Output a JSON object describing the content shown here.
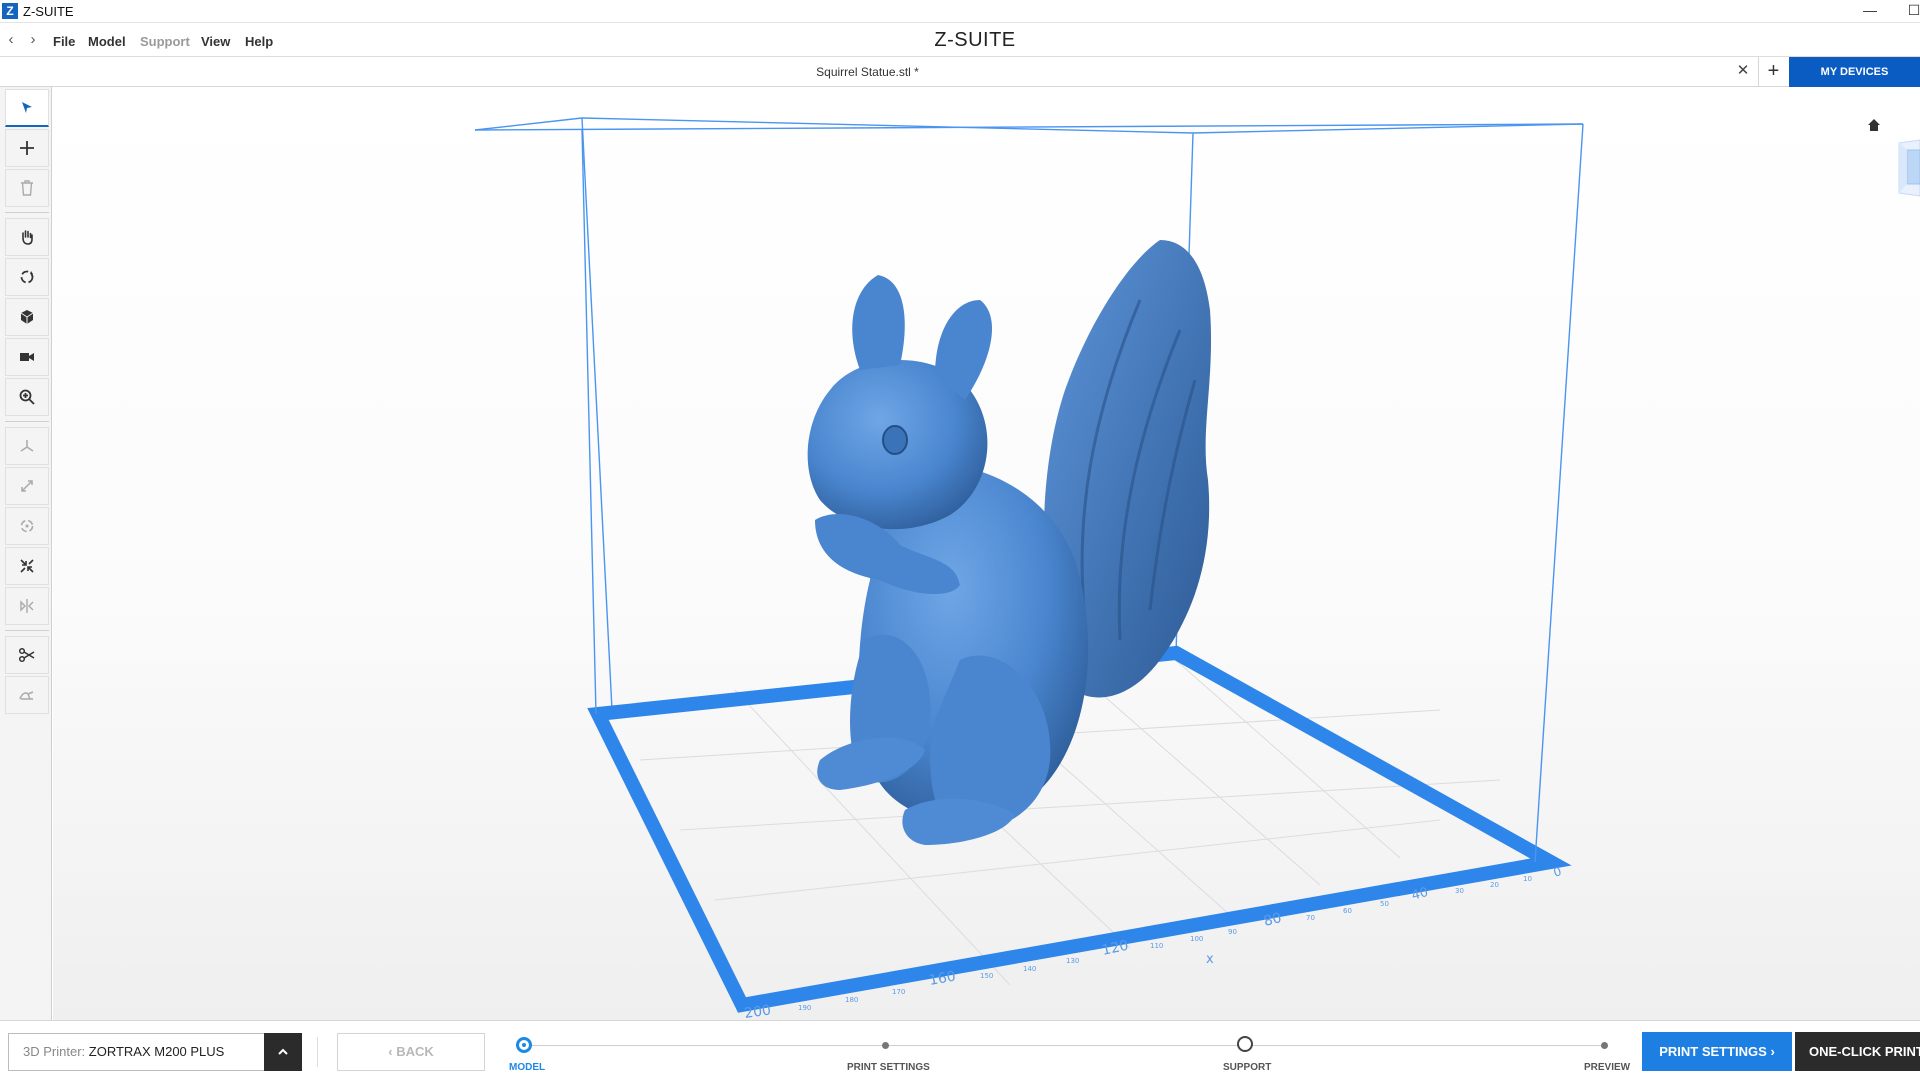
{
  "window": {
    "title": "Z-SUITE",
    "logo_letter": "Z",
    "minimize_glyph": "—",
    "maximize_glyph": "☐"
  },
  "menubar": {
    "brand": "Z-SUITE",
    "items": [
      {
        "label": "File",
        "enabled": true
      },
      {
        "label": "Model",
        "enabled": true
      },
      {
        "label": "Support",
        "enabled": false
      },
      {
        "label": "View",
        "enabled": true
      },
      {
        "label": "Help",
        "enabled": true
      }
    ]
  },
  "tab": {
    "title": "Squirrel Statue.stl *",
    "close_glyph": "✕",
    "add_glyph": "+",
    "my_devices_label": "MY DEVICES"
  },
  "toolbar": {
    "tools": [
      {
        "name": "select-tool",
        "icon": "cursor-icon",
        "active": true,
        "enabled": true
      },
      {
        "name": "add-model-tool",
        "icon": "plus-icon",
        "active": false,
        "enabled": true
      },
      {
        "name": "delete-tool",
        "icon": "trash-icon",
        "active": false,
        "enabled": false
      },
      {
        "name": "pan-tool",
        "icon": "hand-icon",
        "active": false,
        "enabled": true
      },
      {
        "name": "orbit-tool",
        "icon": "rotate-view-icon",
        "active": false,
        "enabled": true
      },
      {
        "name": "view-cube-tool",
        "icon": "cube-icon",
        "active": false,
        "enabled": true
      },
      {
        "name": "camera-tool",
        "icon": "camera-icon",
        "active": false,
        "enabled": true
      },
      {
        "name": "zoom-tool",
        "icon": "zoom-icon",
        "active": false,
        "enabled": true
      },
      {
        "name": "move-tool",
        "icon": "move-axes-icon",
        "active": false,
        "enabled": false
      },
      {
        "name": "scale-tool",
        "icon": "scale-icon",
        "active": false,
        "enabled": false
      },
      {
        "name": "rotate-tool",
        "icon": "rotate-icon",
        "active": false,
        "enabled": false
      },
      {
        "name": "fit-tool",
        "icon": "fit-icon",
        "active": false,
        "enabled": true
      },
      {
        "name": "mirror-tool",
        "icon": "mirror-icon",
        "active": false,
        "enabled": false
      },
      {
        "name": "cut-tool",
        "icon": "scissors-icon",
        "active": false,
        "enabled": true
      },
      {
        "name": "repair-tool",
        "icon": "repair-icon",
        "active": false,
        "enabled": false
      }
    ]
  },
  "viewport": {
    "model_name": "Squirrel Statue.stl",
    "model_color": "#4a86cf",
    "platform_color": "#2f86ea",
    "axis_labels": {
      "x_axis_letter": "x",
      "front_major": [
        "200",
        "160",
        "120",
        "80",
        "40",
        "0"
      ],
      "front_minor": [
        "190",
        "180",
        "170",
        "150",
        "140",
        "130",
        "110",
        "100",
        "90",
        "70",
        "60",
        "50",
        "30",
        "20",
        "10"
      ]
    }
  },
  "bottombar": {
    "printer_label": "3D Printer:",
    "printer_value": "ZORTRAX M200 PLUS",
    "back_label": "BACK",
    "steps": [
      {
        "label": "MODEL",
        "state": "current"
      },
      {
        "label": "PRINT SETTINGS",
        "state": "pending"
      },
      {
        "label": "SUPPORT",
        "state": "locked"
      },
      {
        "label": "PREVIEW",
        "state": "pending"
      }
    ],
    "print_settings_label": "PRINT SETTINGS",
    "one_click_label": "ONE-CLICK PRINT"
  },
  "colors": {
    "accent": "#1e7fe2",
    "dark": "#2b2b2b",
    "my_devices": "#0b5cc2"
  }
}
